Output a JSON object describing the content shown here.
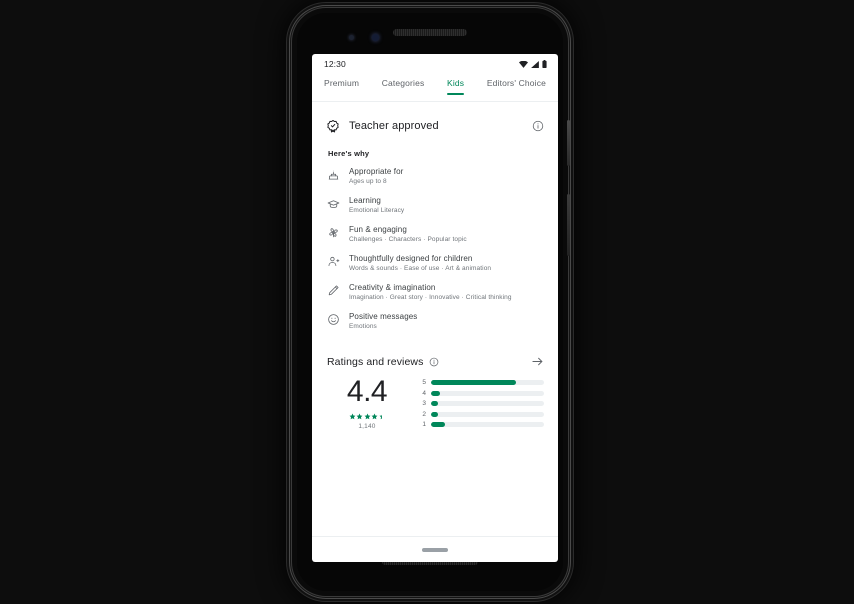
{
  "device": {
    "name": "android-phone-mockup"
  },
  "status_bar": {
    "time": "12:30",
    "icons": [
      "wifi-icon",
      "cellular-signal-icon",
      "battery-icon"
    ]
  },
  "tabs": [
    {
      "label": "Premium",
      "active": false
    },
    {
      "label": "Categories",
      "active": false
    },
    {
      "label": "Kids",
      "active": true
    },
    {
      "label": "Editors' Choice",
      "active": false
    }
  ],
  "teacher_approved": {
    "title": "Teacher approved",
    "badge_icon": "verified-badge-icon",
    "info_icon": "info-circle-icon"
  },
  "heres_why": {
    "heading": "Here's why",
    "items": [
      {
        "icon": "cake-icon",
        "label": "Appropriate for",
        "sub": "Ages up to 8"
      },
      {
        "icon": "graduation-cap-icon",
        "label": "Learning",
        "sub": "Emotional Literacy"
      },
      {
        "icon": "pinwheel-toy-icon",
        "label": "Fun & engaging",
        "sub": "Challenges · Characters · Popular topic"
      },
      {
        "icon": "person-add-icon",
        "label": "Thoughtfully designed for children",
        "sub": "Words & sounds · Ease of use · Art & animation"
      },
      {
        "icon": "pencil-icon",
        "label": "Creativity & imagination",
        "sub": "Imagination · Great story · Innovative · Critical thinking"
      },
      {
        "icon": "smiley-face-icon",
        "label": "Positive messages",
        "sub": "Emotions"
      }
    ]
  },
  "ratings": {
    "title": "Ratings and reviews",
    "info_icon": "info-circle-icon",
    "arrow_icon": "arrow-right-icon",
    "score": "4.4",
    "stars_filled": 4,
    "stars_partial": 0.4,
    "review_count": "1,140",
    "histogram": [
      {
        "stars": "5",
        "percent": 75
      },
      {
        "stars": "4",
        "percent": 8
      },
      {
        "stars": "3",
        "percent": 4
      },
      {
        "stars": "2",
        "percent": 4
      },
      {
        "stars": "1",
        "percent": 12
      }
    ]
  },
  "nav": {
    "gesture_bar": "home-gesture-pill"
  },
  "colors": {
    "accent_green": "#00875A",
    "page_background": "#0d0d0d",
    "screen_background": "#ffffff",
    "primary_text": "#202124",
    "secondary_text": "#5f6368",
    "tertiary_text": "#70757a",
    "track_grey": "#eceff1"
  }
}
